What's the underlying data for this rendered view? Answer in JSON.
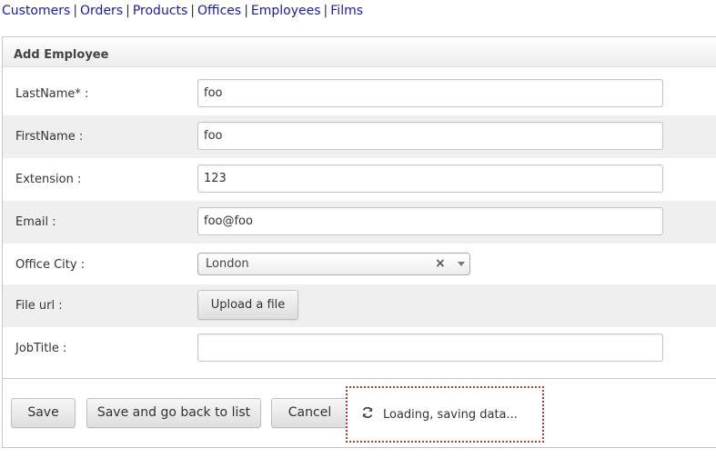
{
  "nav": {
    "links": [
      "Customers",
      "Orders",
      "Products",
      "Offices",
      "Employees",
      "Films"
    ],
    "separator": "|"
  },
  "form": {
    "title": "Add Employee",
    "fields": {
      "lastname": {
        "label": "LastName* :",
        "value": "foo"
      },
      "firstname": {
        "label": "FirstName :",
        "value": "foo"
      },
      "extension": {
        "label": "Extension :",
        "value": "123"
      },
      "email": {
        "label": "Email :",
        "value": "foo@foo"
      },
      "office_city": {
        "label": "Office City :",
        "value": "London",
        "clear": "×"
      },
      "file_url": {
        "label": "File url :",
        "button": "Upload a file"
      },
      "jobtitle": {
        "label": "JobTitle :",
        "value": ""
      }
    },
    "buttons": {
      "save": "Save",
      "save_back": "Save and go back to list",
      "cancel": "Cancel"
    },
    "loading": {
      "text": "Loading, saving data...",
      "icon": "refresh-icon"
    }
  },
  "colors": {
    "link": "#1a1aa6",
    "alt_row": "#efefef",
    "loading_border": "#c0392b"
  }
}
